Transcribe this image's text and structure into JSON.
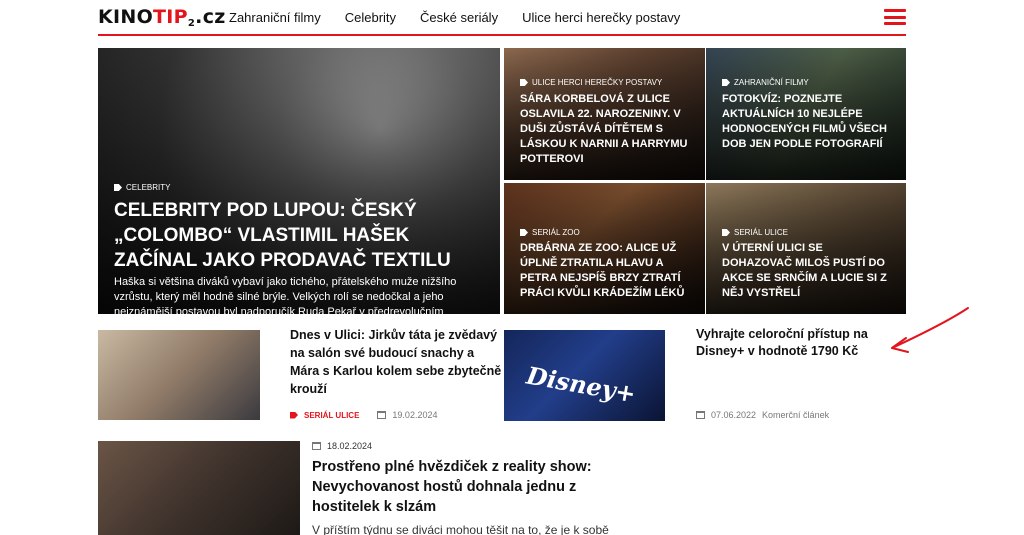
{
  "header": {
    "logo": {
      "a": "KINO",
      "b": "TIP",
      "sub": "2",
      "c": ".cz"
    },
    "nav": [
      "Zahraniční filmy",
      "Celebrity",
      "České seriály",
      "Ulice herci herečky postavy"
    ],
    "menu_icon": "hamburger-icon"
  },
  "hero": {
    "category": "CELEBRITY",
    "title": "CELEBRITY POD LUPOU: ČESKÝ „COLOMBO“ VLASTIMIL HAŠEK ZAČÍNAL JAKO PRODAVAČ TEXTILU",
    "perex": "Haška si většina diváků vybaví jako tichého, přátelského muže nižšího vzrůstu, který měl hodně silné brýle. Velkých rolí se nedočkal a jeho nejznámější postavou byl nadporučík Ruda Pekař v předrevolučním kriminálním seriálu Malý pitaval z velkého města."
  },
  "tiles": [
    {
      "category": "ULICE HERCI HEREČKY POSTAVY",
      "title": "SÁRA KORBELOVÁ Z ULICE OSLAVILA 22. NAROZENINY. V DUŠI ZŮSTÁVÁ DÍTĚTEM S LÁSKOU K NARNII A HARRYMU POTTEROVI"
    },
    {
      "category": "ZAHRANIČNÍ FILMY",
      "title": "FOTOKVÍZ: POZNEJTE AKTUÁLNÍCH 10 NEJLÉPE HODNOCENÝCH FILMŮ VŠECH DOB JEN PODLE FOTOGRAFIÍ"
    },
    {
      "category": "SERIÁL ZOO",
      "title": "DRBÁRNA ZE ZOO: ALICE UŽ ÚPLNĚ ZTRATILA HLAVU A PETRA NEJSPÍŠ BRZY ZTRATÍ PRÁCI KVŮLI KRÁDEŽÍM LÉKŮ"
    },
    {
      "category": "SERIÁL ULICE",
      "title": "V ÚTERNÍ ULICI SE DOHAZOVAČ MILOŠ PUSTÍ DO AKCE SE SRNČÍM A LUCIE SI Z NĚJ VYSTŘELÍ"
    }
  ],
  "articles": [
    {
      "title": "Dnes v Ulici: Jirkův táta je zvědavý na salón své budoucí snachy a Mára s Karlou kolem sebe zbytečně krouží",
      "category": "SERIÁL ULICE",
      "date": "19.02.2024"
    },
    {
      "title": "Vyhrajte celoroční přístup na Disney+ v hodnotě 1790 Kč",
      "date": "07.06.2022",
      "label": "Komerční článek",
      "thumb_text": "Disney+"
    },
    {
      "title": "Prostřeno plné hvězdiček z reality show: Nevychovanost hostů dohnala jednu z hostitelek k slzám",
      "date": "18.02.2024",
      "perex": "V příštím týdnu se diváci mohou těšit na to, že je k sobě"
    }
  ],
  "colors": {
    "accent": "#e3141c",
    "annotation": "#e3141c"
  }
}
